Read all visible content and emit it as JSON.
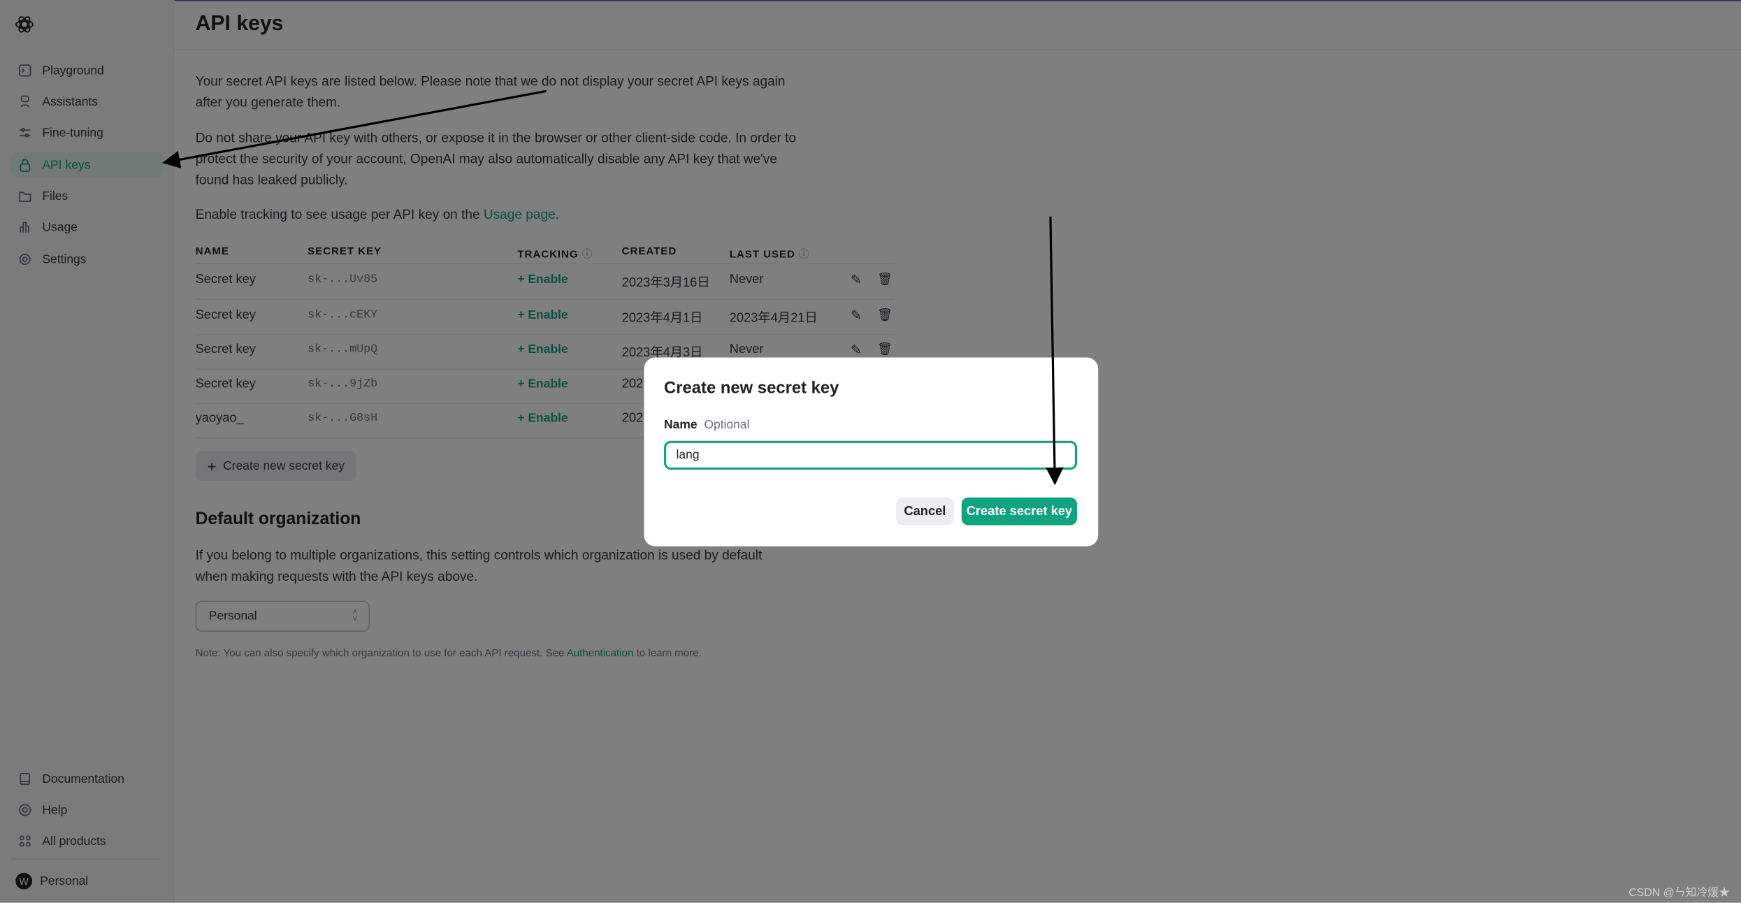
{
  "sidebar": {
    "items": [
      {
        "label": "Playground",
        "icon": "terminal-icon"
      },
      {
        "label": "Assistants",
        "icon": "robot-icon"
      },
      {
        "label": "Fine-tuning",
        "icon": "sliders-icon"
      },
      {
        "label": "API keys",
        "icon": "lock-icon",
        "active": true
      },
      {
        "label": "Files",
        "icon": "folder-icon"
      },
      {
        "label": "Usage",
        "icon": "bar-chart-icon"
      },
      {
        "label": "Settings",
        "icon": "gear-icon"
      }
    ],
    "bottom": [
      {
        "label": "Documentation",
        "icon": "book-icon"
      },
      {
        "label": "Help",
        "icon": "lifebuoy-icon"
      },
      {
        "label": "All products",
        "icon": "grid-icon"
      }
    ],
    "account": {
      "label": "Personal",
      "avatar": "W"
    }
  },
  "header": {
    "title": "API keys"
  },
  "intro": {
    "p1a": "Your secret API keys are listed below. Please note that we do not display your secret API keys again",
    "p1b": "after you generate them.",
    "p2a": "Do not share your API key with others, or expose it in the browser or other client-side code. In order to",
    "p2b": "protect the security of your account, OpenAI may also automatically disable any API key that we've",
    "p2c": "found has leaked publicly.",
    "p3": "Enable tracking to see usage per API key on the ",
    "p3link": "Usage page",
    "p3end": "."
  },
  "table": {
    "headers": [
      "NAME",
      "SECRET KEY",
      "TRACKING",
      "CREATED",
      "LAST USED"
    ],
    "rows": [
      {
        "name": "Secret key",
        "key": "sk-...Uv85",
        "tracking": "+ Enable",
        "created": "2023年3月16日",
        "last_used": "Never"
      },
      {
        "name": "Secret key",
        "key": "sk-...cEKY",
        "tracking": "+ Enable",
        "created": "2023年4月1日",
        "last_used": "2023年4月21日"
      },
      {
        "name": "Secret key",
        "key": "sk-...mUpQ",
        "tracking": "+ Enable",
        "created": "2023年4月3日",
        "last_used": "Never"
      },
      {
        "name": "Secret key",
        "key": "sk-...9jZb",
        "tracking": "+ Enable",
        "created": "202",
        "last_used": ""
      },
      {
        "name": "yaoyao_",
        "key": "sk-...G8sH",
        "tracking": "+ Enable",
        "created": "202",
        "last_used": ""
      }
    ]
  },
  "create_button": "Create new secret key",
  "org": {
    "title": "Default organization",
    "p1": "If you belong to multiple organizations, this setting controls which organization is used by default",
    "p2": "when making requests with the API keys above.",
    "select": "Personal",
    "note": "Note: You can also specify which organization to use for each API request. See ",
    "note_link": "Authentication",
    "note_end": " to learn more."
  },
  "modal": {
    "title": "Create new secret key",
    "label": "Name",
    "optional": "Optional",
    "input_value": "lang",
    "cancel": "Cancel",
    "submit": "Create secret key"
  },
  "watermark": "CSDN @ㄣ知冷煖★",
  "colors": {
    "accent": "#10a37f",
    "overlay": "rgba(0,0,0,0.5)"
  }
}
